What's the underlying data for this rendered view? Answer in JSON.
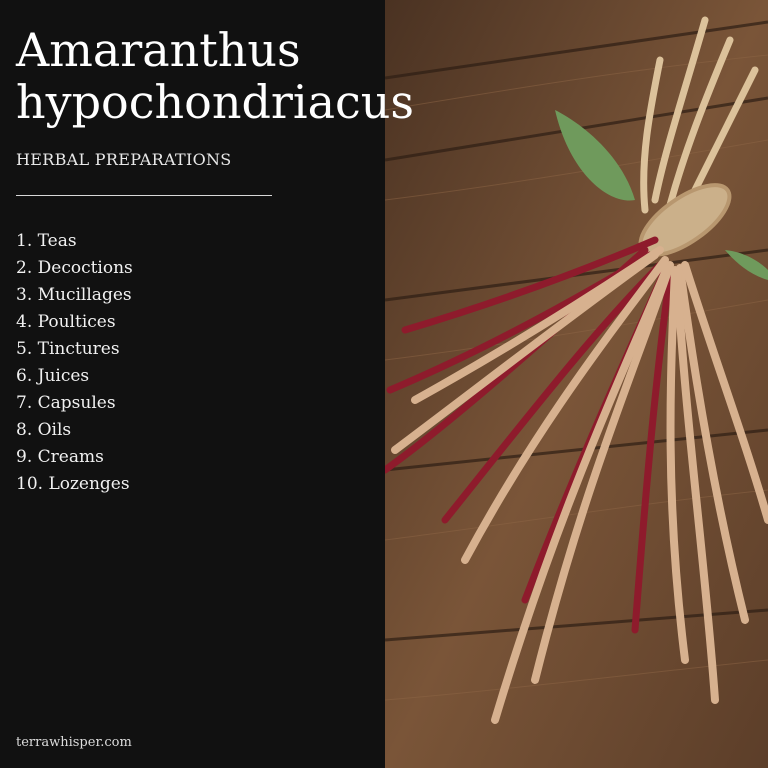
{
  "title_line1": "Amaranthus",
  "title_line2": "hypochondriacus",
  "subtitle": "HERBAL PREPARATIONS",
  "items": [
    "1. Teas",
    "2. Decoctions",
    "3. Mucillages",
    "4. Poultices",
    "5. Tinctures",
    "6. Juices",
    "7. Capsules",
    "8. Oils",
    "9. Creams",
    "10. Lozenges"
  ],
  "footer": "terrawhisper.com",
  "colors": {
    "panel": "#111111",
    "text": "#ffffff",
    "wood": "#6b4a33",
    "amaranth_red": "#8e1b2c",
    "amaranth_tan": "#d7b18f"
  }
}
